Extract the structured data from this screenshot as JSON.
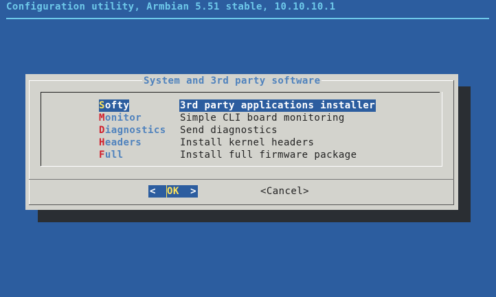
{
  "backtitle": "Configuration utility, Armbian 5.51 stable, 10.10.10.1",
  "dialog": {
    "title": "System and 3rd party software",
    "menu": [
      {
        "hotkey": "S",
        "rest": "ofty",
        "description": "3rd party applications installer",
        "selected": true
      },
      {
        "hotkey": "M",
        "rest": "onitor",
        "description": "Simple CLI board monitoring",
        "selected": false
      },
      {
        "hotkey": "D",
        "rest": "iagnostics",
        "description": "Send diagnostics",
        "selected": false
      },
      {
        "hotkey": "H",
        "rest": "eaders",
        "description": "Install kernel headers",
        "selected": false
      },
      {
        "hotkey": "F",
        "rest": "ull",
        "description": "Install full firmware package",
        "selected": false
      }
    ],
    "buttons": {
      "ok": {
        "left": "<",
        "label": "OK",
        "right": ">"
      },
      "cancel": "<Cancel>"
    }
  },
  "colors": {
    "background": "#2c5d9f",
    "dialog": "#d3d3cd",
    "highlight": "#2c5d9f",
    "hotkey": "#d1202c",
    "selected_hotkey": "#ffe55c",
    "backtitle": "#6ec9ea"
  }
}
